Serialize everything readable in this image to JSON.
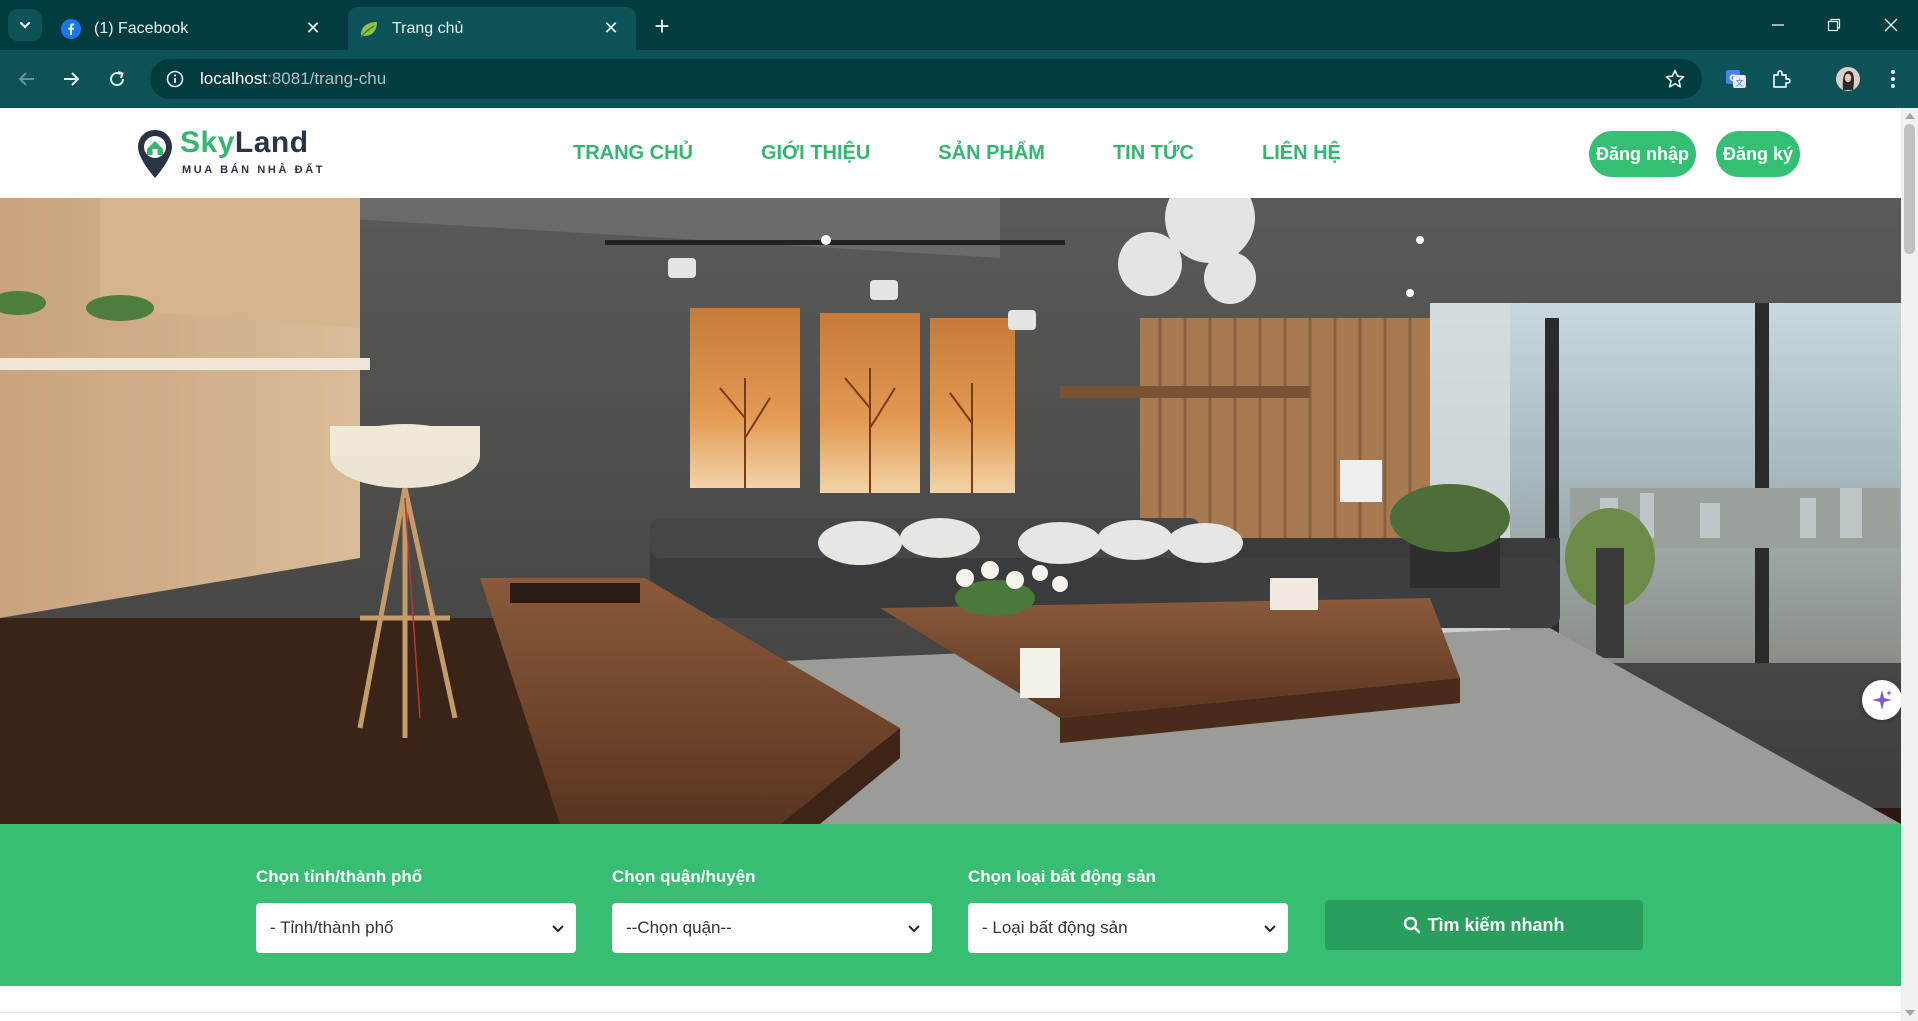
{
  "browser": {
    "tabs": [
      {
        "title": "(1) Facebook"
      },
      {
        "title": "Trang chủ"
      }
    ],
    "url_host": "localhost",
    "url_rest": ":8081/trang-chu",
    "colors": {
      "chrome_dark": "#003c3f",
      "chrome_toolbar": "#0c5257"
    }
  },
  "site": {
    "logo": {
      "name_part1": "Sky",
      "name_part2": "Land",
      "tagline": "MUA BÁN NHÀ ĐẤT"
    },
    "nav": [
      "TRANG CHỦ",
      "GIỚI THIỆU",
      "SẢN PHẨM",
      "TIN TỨC",
      "LIÊN HỆ"
    ],
    "auth": {
      "login": "Đăng nhập",
      "register": "Đăng ký"
    },
    "colors": {
      "brand_green": "#35b56f",
      "band_green": "#37be73",
      "button_green": "#2a9e5c"
    }
  },
  "search": {
    "province": {
      "label": "Chọn tỉnh/thành phố",
      "selected": "- Tỉnh/thành phố"
    },
    "district": {
      "label": "Chọn quận/huyện",
      "selected": "--Chọn quận--"
    },
    "property_type": {
      "label": "Chọn loại bất động sản",
      "selected": "- Loại bất động sản"
    },
    "button": "Tìm kiếm nhanh"
  }
}
